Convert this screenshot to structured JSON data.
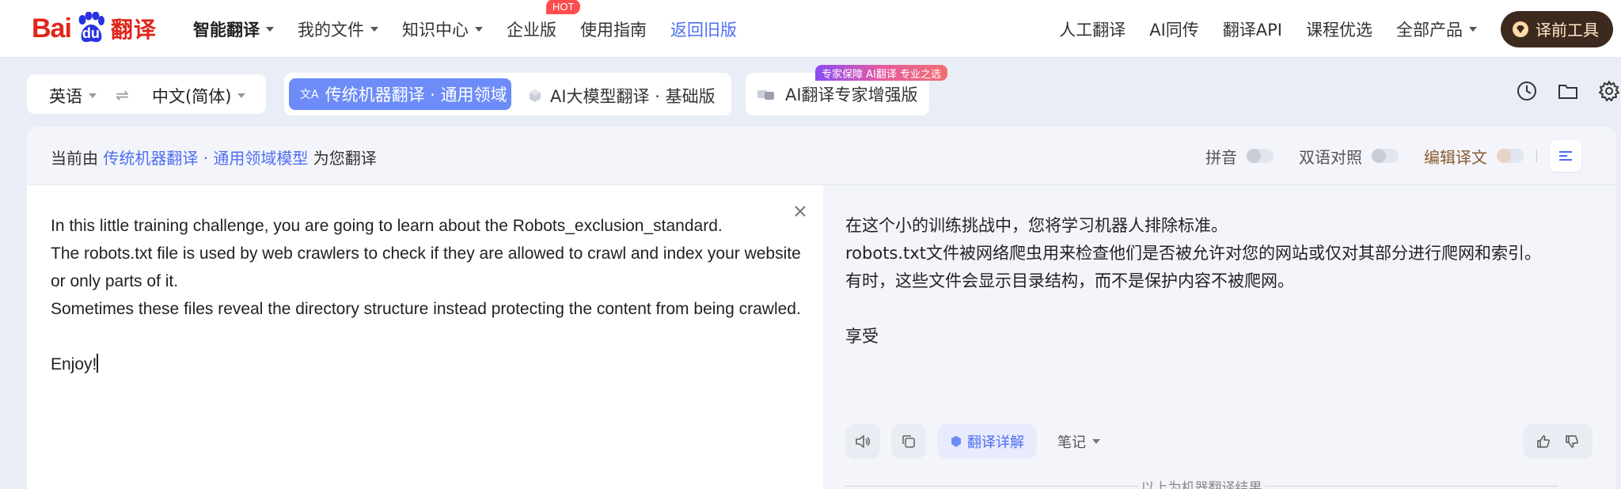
{
  "brand": {
    "logo_bai": "Bai",
    "logo_du": "du",
    "logo_fanyi": "翻译"
  },
  "nav": {
    "left": [
      {
        "label": "智能翻译",
        "dropdown": true
      },
      {
        "label": "我的文件",
        "dropdown": true
      },
      {
        "label": "知识中心",
        "dropdown": true
      },
      {
        "label": "企业版",
        "badge": "HOT"
      },
      {
        "label": "使用指南"
      },
      {
        "label": "返回旧版"
      }
    ],
    "right": [
      {
        "label": "人工翻译"
      },
      {
        "label": "AI同传"
      },
      {
        "label": "翻译API"
      },
      {
        "label": "课程优选"
      },
      {
        "label": "全部产品",
        "dropdown": true
      }
    ],
    "tool_button": "译前工具"
  },
  "language": {
    "source": "英语",
    "target": "中文(简体)"
  },
  "modes": {
    "active": "传统机器翻译 · 通用领域",
    "second": "AI大模型翻译 · 基础版",
    "expert": "AI翻译专家增强版",
    "expert_badge": "专家保障 AI翻译 专业之选"
  },
  "panel": {
    "head_prefix": "当前由",
    "head_link": "传统机器翻译 · 通用领域模型",
    "head_suffix": "为您翻译",
    "toggles": {
      "pinyin": "拼音",
      "bilingual": "双语对照",
      "edit": "编辑译文"
    }
  },
  "source_text": "In this little training challenge, you are going to learn about the Robots_exclusion_standard.\nThe robots.txt file is used by web crawlers to check if they are allowed to crawl and index your website or only parts of it.\nSometimes these files reveal the directory structure instead protecting the content from being crawled.\n\nEnjoy!",
  "target_lines": [
    "在这个小的训练挑战中，您将学习机器人排除标准。",
    "robots.txt文件被网络爬虫用来检查他们是否被允许对您的网站或仅对其部分进行爬网和索引。",
    "有时，这些文件会显示目录结构，而不是保护内容不被爬网。",
    "",
    "享受"
  ],
  "actions": {
    "detail": "翻译详解",
    "notes": "笔记",
    "machine_note": "以上为机器翻译结果"
  },
  "colors": {
    "accent": "#4e6ef2",
    "active_mode": "#6d8cf7",
    "brand_red": "#e1251b",
    "hot": "#ff4d4f"
  }
}
